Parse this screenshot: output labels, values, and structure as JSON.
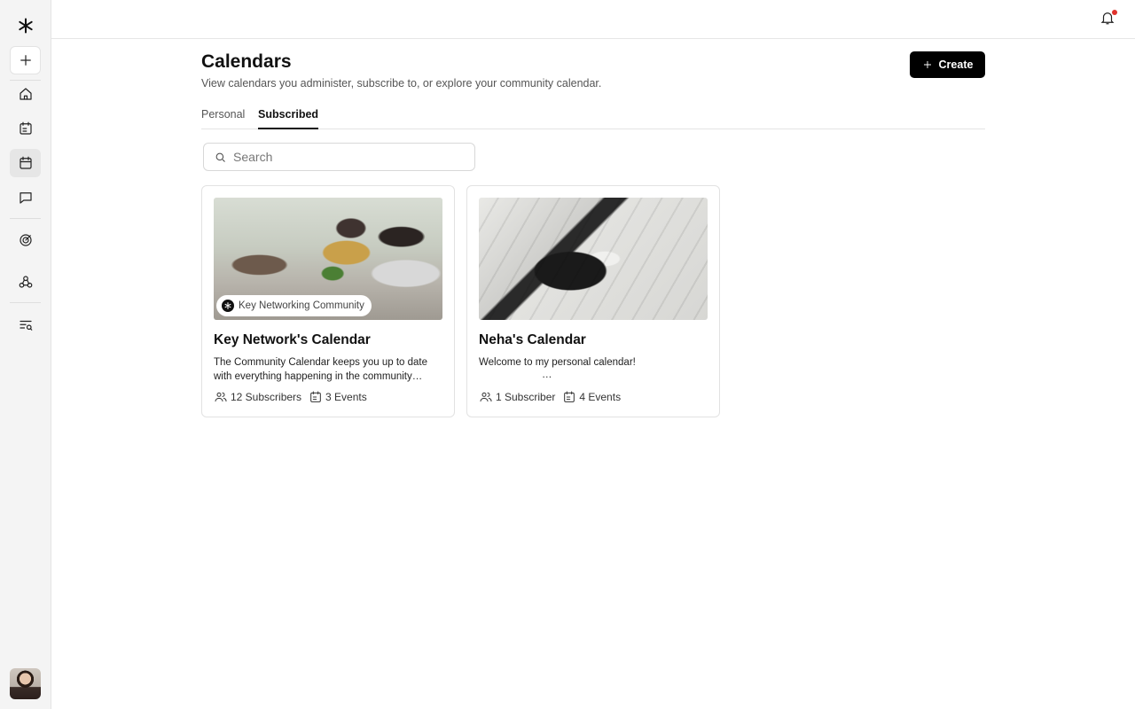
{
  "sidebar": {
    "items": [
      {
        "name": "create",
        "icon": "plus-icon"
      },
      {
        "name": "home",
        "icon": "home-icon"
      },
      {
        "name": "events",
        "icon": "event-icon"
      },
      {
        "name": "calendars",
        "icon": "calendar-icon",
        "active": true
      },
      {
        "name": "messages",
        "icon": "chat-icon"
      },
      {
        "name": "analytics",
        "icon": "target-icon"
      },
      {
        "name": "integrations",
        "icon": "webhook-icon"
      },
      {
        "name": "search-list",
        "icon": "list-search-icon"
      }
    ]
  },
  "header": {
    "title": "Calendars",
    "subtitle": "View calendars you administer, subscribe to, or explore your community calendar.",
    "create_label": "Create"
  },
  "tabs": [
    {
      "label": "Personal",
      "active": false
    },
    {
      "label": "Subscribed",
      "active": true
    }
  ],
  "search": {
    "placeholder": "Search",
    "value": ""
  },
  "calendars": [
    {
      "title": "Key Network's Calendar",
      "tag": "Key Networking Community",
      "description": "The Community Calendar keeps you up to date with everything happening in the community…",
      "subscribers": "12 Subscribers",
      "events": "3 Events"
    },
    {
      "title": "Neha's Calendar",
      "description": "Welcome to my personal calendar!",
      "ellipsis": "…",
      "subscribers": "1 Subscriber",
      "events": "4 Events"
    }
  ],
  "colors": {
    "accent": "#000000",
    "notification": "#e0322c",
    "sidebar_bg": "#f4f4f4"
  }
}
